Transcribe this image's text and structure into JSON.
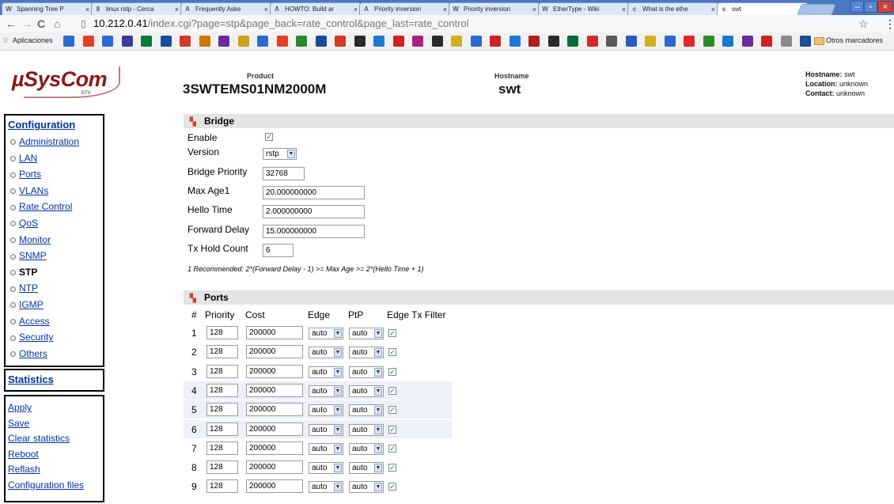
{
  "browser": {
    "tabs": [
      {
        "title": "Spanning Tree P",
        "icon": "W"
      },
      {
        "title": "linux rstp - Cerca",
        "icon": "8"
      },
      {
        "title": "Frequently Aske",
        "icon": "A"
      },
      {
        "title": "HOWTO: Build ar",
        "icon": "A"
      },
      {
        "title": "Priority inversion",
        "icon": "A"
      },
      {
        "title": "Priority inversion",
        "icon": "W"
      },
      {
        "title": "EtherType - Wiki",
        "icon": "W"
      },
      {
        "title": "What is the ethe",
        "icon": "c"
      },
      {
        "title": "swt",
        "icon": "s"
      }
    ],
    "url_host": "10.212.0.41",
    "url_path": "/index.cgi?page=stp&page_back=rate_control&page_last=rate_control",
    "bookmarks_label": "Aplicaciones",
    "other_bookmarks_label": "Otros marcadores"
  },
  "header": {
    "logo_text": "µSysCom",
    "logo_sub": "ETV",
    "product_label": "Product",
    "product_value": "3SWTEMS01NM2000M",
    "hostname_label": "Hostname",
    "hostname_value": "swt",
    "info": {
      "hostname_label": "Hostname:",
      "hostname": "swt",
      "location_label": "Location:",
      "location": "unknown",
      "contact_label": "Contact:",
      "contact": "unknown"
    }
  },
  "sidebar": {
    "config_title": "Configuration",
    "items": [
      {
        "label": "Administration",
        "current": false
      },
      {
        "label": "LAN",
        "current": false
      },
      {
        "label": "Ports",
        "current": false
      },
      {
        "label": "VLANs",
        "current": false
      },
      {
        "label": "Rate Control",
        "current": false
      },
      {
        "label": "QoS",
        "current": false
      },
      {
        "label": "Monitor",
        "current": false
      },
      {
        "label": "SNMP",
        "current": false
      },
      {
        "label": "STP",
        "current": true
      },
      {
        "label": "NTP",
        "current": false
      },
      {
        "label": "IGMP",
        "current": false
      },
      {
        "label": "Access",
        "current": false
      },
      {
        "label": "Security",
        "current": false
      },
      {
        "label": "Others",
        "current": false
      }
    ],
    "stats_title": "Statistics",
    "actions": [
      "Apply",
      "Save",
      "Clear statistics",
      "Reboot",
      "Reflash",
      "Configuration files"
    ]
  },
  "bridge": {
    "title": "Bridge",
    "enable_label": "Enable",
    "enable_checked": true,
    "version_label": "Version",
    "version_value": "rstp",
    "priority_label": "Bridge Priority",
    "priority_value": "32768",
    "max_age_label": "Max Age1",
    "max_age_value": "20.000000000",
    "hello_label": "Hello Time",
    "hello_value": "2.000000000",
    "forward_label": "Forward Delay",
    "forward_value": "15.000000000",
    "hold_label": "Tx Hold Count",
    "hold_value": "6",
    "note": "1 Recommended: 2*(Forward Delay - 1) >= Max Age >= 2*(Hello Time + 1)"
  },
  "ports": {
    "title": "Ports",
    "columns": [
      "#",
      "Priority",
      "Cost",
      "Edge",
      "PtP",
      "Edge Tx Filter"
    ],
    "rows": [
      {
        "num": "1",
        "priority": "128",
        "cost": "200000",
        "edge": "auto",
        "ptp": "auto",
        "filter": true,
        "shaded": false
      },
      {
        "num": "2",
        "priority": "128",
        "cost": "200000",
        "edge": "auto",
        "ptp": "auto",
        "filter": true,
        "shaded": false
      },
      {
        "num": "3",
        "priority": "128",
        "cost": "200000",
        "edge": "auto",
        "ptp": "auto",
        "filter": true,
        "shaded": false
      },
      {
        "num": "4",
        "priority": "128",
        "cost": "200000",
        "edge": "auto",
        "ptp": "auto",
        "filter": true,
        "shaded": true
      },
      {
        "num": "5",
        "priority": "128",
        "cost": "200000",
        "edge": "auto",
        "ptp": "auto",
        "filter": true,
        "shaded": true
      },
      {
        "num": "6",
        "priority": "128",
        "cost": "200000",
        "edge": "auto",
        "ptp": "auto",
        "filter": true,
        "shaded": true
      },
      {
        "num": "7",
        "priority": "128",
        "cost": "200000",
        "edge": "auto",
        "ptp": "auto",
        "filter": true,
        "shaded": false
      },
      {
        "num": "8",
        "priority": "128",
        "cost": "200000",
        "edge": "auto",
        "ptp": "auto",
        "filter": true,
        "shaded": false
      },
      {
        "num": "9",
        "priority": "128",
        "cost": "200000",
        "edge": "auto",
        "ptp": "auto",
        "filter": true,
        "shaded": false
      }
    ]
  },
  "colors": {
    "brand": "#8b1818",
    "link": "#0033a0",
    "section_bg": "#e4e4e4",
    "row_shade": "#eef0fa"
  }
}
